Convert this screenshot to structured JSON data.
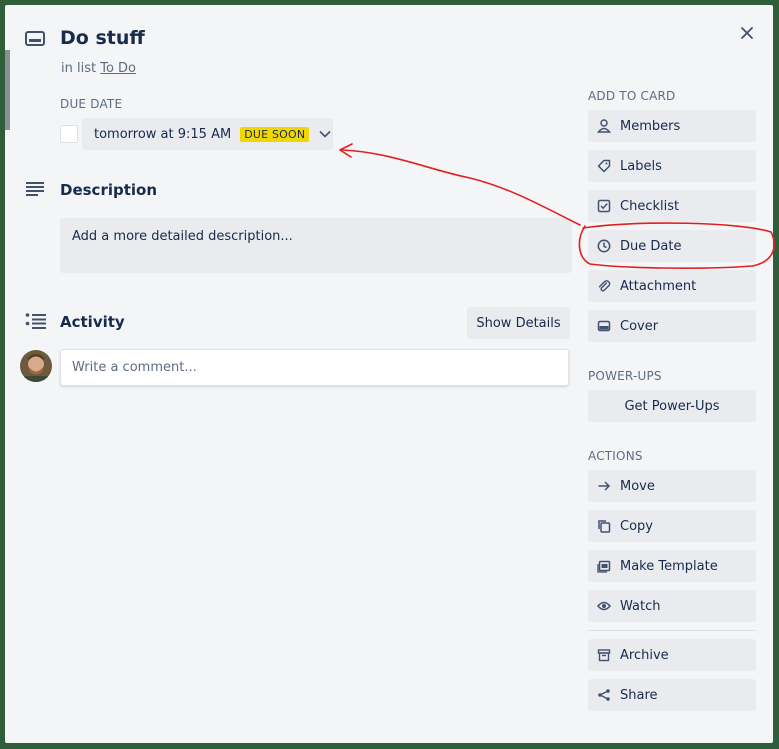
{
  "card": {
    "title": "Do stuff",
    "list_prefix": "in list",
    "list_name": "To Do"
  },
  "due_date": {
    "label": "DUE DATE",
    "value": "tomorrow at 9:15 AM",
    "badge": "DUE SOON",
    "badge_color": "#f2d600"
  },
  "description": {
    "title": "Description",
    "placeholder": "Add a more detailed description..."
  },
  "activity": {
    "title": "Activity",
    "show_details": "Show Details",
    "comment_placeholder": "Write a comment..."
  },
  "sidebar": {
    "add_to_card": {
      "heading": "ADD TO CARD",
      "items": [
        {
          "label": "Members",
          "icon": "person-icon"
        },
        {
          "label": "Labels",
          "icon": "tag-icon"
        },
        {
          "label": "Checklist",
          "icon": "checkbox-icon"
        },
        {
          "label": "Due Date",
          "icon": "clock-icon"
        },
        {
          "label": "Attachment",
          "icon": "paperclip-icon"
        },
        {
          "label": "Cover",
          "icon": "cover-icon"
        }
      ]
    },
    "power_ups": {
      "heading": "POWER-UPS",
      "button": "Get Power-Ups"
    },
    "actions": {
      "heading": "ACTIONS",
      "items": [
        {
          "label": "Move",
          "icon": "arrow-right-icon"
        },
        {
          "label": "Copy",
          "icon": "copy-icon"
        },
        {
          "label": "Make Template",
          "icon": "template-icon"
        },
        {
          "label": "Watch",
          "icon": "eye-icon"
        },
        {
          "label": "Archive",
          "icon": "archive-icon"
        },
        {
          "label": "Share",
          "icon": "share-icon"
        }
      ]
    }
  },
  "colors": {
    "modal_bg": "#f4f5f7",
    "button_bg": "#e9ebee",
    "text": "#172b4d",
    "muted": "#5e6c84",
    "annotation": "#e02020"
  }
}
